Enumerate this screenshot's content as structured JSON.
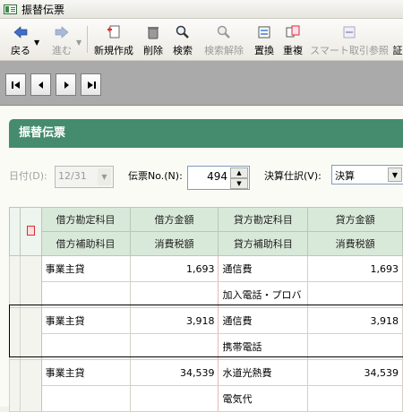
{
  "window": {
    "title": "振替伝票"
  },
  "toolbar": {
    "back": "戻る",
    "forward": "進む",
    "new": "新規作成",
    "delete": "削除",
    "search": "検索",
    "search_cancel": "検索解除",
    "replace": "置換",
    "duplicate": "重複",
    "smart": "スマート取引参照",
    "proof": "証"
  },
  "section_title": "振替伝票",
  "form": {
    "date_label": "日付(D):",
    "date_value": "12/31",
    "slip_label": "伝票No.(N):",
    "slip_value": "494",
    "settle_label": "決算仕訳(V):",
    "settle_value": "決算"
  },
  "table": {
    "headers_top": [
      "借方勘定科目",
      "借方金額",
      "貸方勘定科目",
      "貸方金額"
    ],
    "headers_bottom": [
      "借方補助科目",
      "消費税額",
      "貸方補助科目",
      "消費税額"
    ],
    "rows": [
      {
        "debit_account": "事業主貸",
        "debit_amount": "1,693",
        "credit_account": "通信費",
        "credit_amount": "1,693",
        "credit_sub": "加入電話・プロバ"
      },
      {
        "debit_account": "事業主貸",
        "debit_amount": "3,918",
        "credit_account": "通信費",
        "credit_amount": "3,918",
        "credit_sub": "携帯電話"
      },
      {
        "debit_account": "事業主貸",
        "debit_amount": "34,539",
        "credit_account": "水道光熱費",
        "credit_amount": "34,539",
        "credit_sub": "電気代"
      }
    ]
  },
  "colors": {
    "accent": "#458b6e",
    "header_bg": "#d9e9d9",
    "nav_bg": "#aaaaaa"
  },
  "icons": [
    "back-arrow-icon",
    "forward-arrow-icon",
    "new-doc-icon",
    "trash-icon",
    "magnifier-icon",
    "search-cancel-icon",
    "replace-icon",
    "duplicate-icon",
    "smart-reference-icon"
  ]
}
